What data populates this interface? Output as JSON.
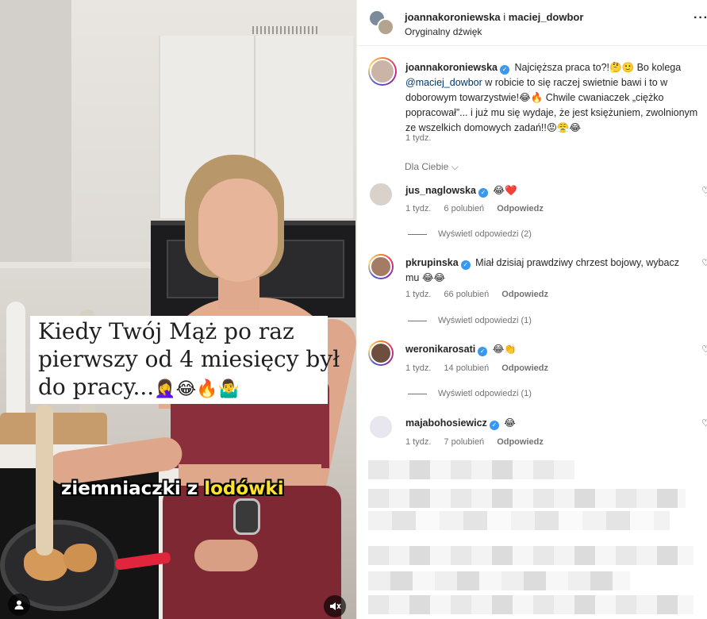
{
  "video": {
    "caption_lines": [
      "Kiedy Twój Mąż po raz",
      "pierwszy od 4 miesięcy był",
      "do pracy..."
    ],
    "caption_emojis": "🤦‍♀️😂🔥🤷‍♂️",
    "subtitle_prefix": "ziemniaczki z ",
    "subtitle_highlight": "lodówki",
    "icons": {
      "user": "user-icon",
      "mute": "volume-mute-icon"
    }
  },
  "header": {
    "user1": "joannakoroniewska",
    "separator": " i ",
    "user2": "maciej_dowbor",
    "audio": "Oryginalny dźwięk",
    "more": "···"
  },
  "caption": {
    "username": "joannakoroniewska",
    "text_part1": " Najcięższa praca to?!🤔🙂 Bo kolega ",
    "mention": "@maciej_dowbor",
    "text_part2": " w robicie to się raczej swietnie bawi i to w doborowym towarzystwie!😂🔥 Chwile cwaniaczek „ciężko popracował”... i już mu się wydaje, że jest księżuniem, zwolnionym ze wszelkich domowych zadań!!😡😤😂",
    "time": "1 tydz."
  },
  "filter": {
    "label": "Dla Ciebie ⌵"
  },
  "comments": [
    {
      "username": "jus_naglowska",
      "text": " 😂❤️",
      "time": "1 tydz.",
      "likes": "6 polubień",
      "reply": "Odpowiedz",
      "replies": "Wyświetl odpowiedzi (2)"
    },
    {
      "username": "pkrupinska",
      "text": " Miał dzisiaj prawdziwy chrzest bojowy, wybacz mu 😂😂",
      "time": "1 tydz.",
      "likes": "66 polubień",
      "reply": "Odpowiedz",
      "replies": "Wyświetl odpowiedzi (1)"
    },
    {
      "username": "weronikarosati",
      "text": " 😂👏",
      "time": "1 tydz.",
      "likes": "14 polubień",
      "reply": "Odpowiedz",
      "replies": "Wyświetl odpowiedzi (1)"
    },
    {
      "username": "majabohosiewicz",
      "text": " 😂",
      "time": "1 tydz.",
      "likes": "7 polubień",
      "reply": "Odpowiedz",
      "replies": ""
    }
  ],
  "colors": {
    "accent": "#3897f0",
    "link": "#00376b",
    "muted": "#737373",
    "caption_bg": "#ffffff",
    "subtitle_highlight": "#ffe32b"
  }
}
